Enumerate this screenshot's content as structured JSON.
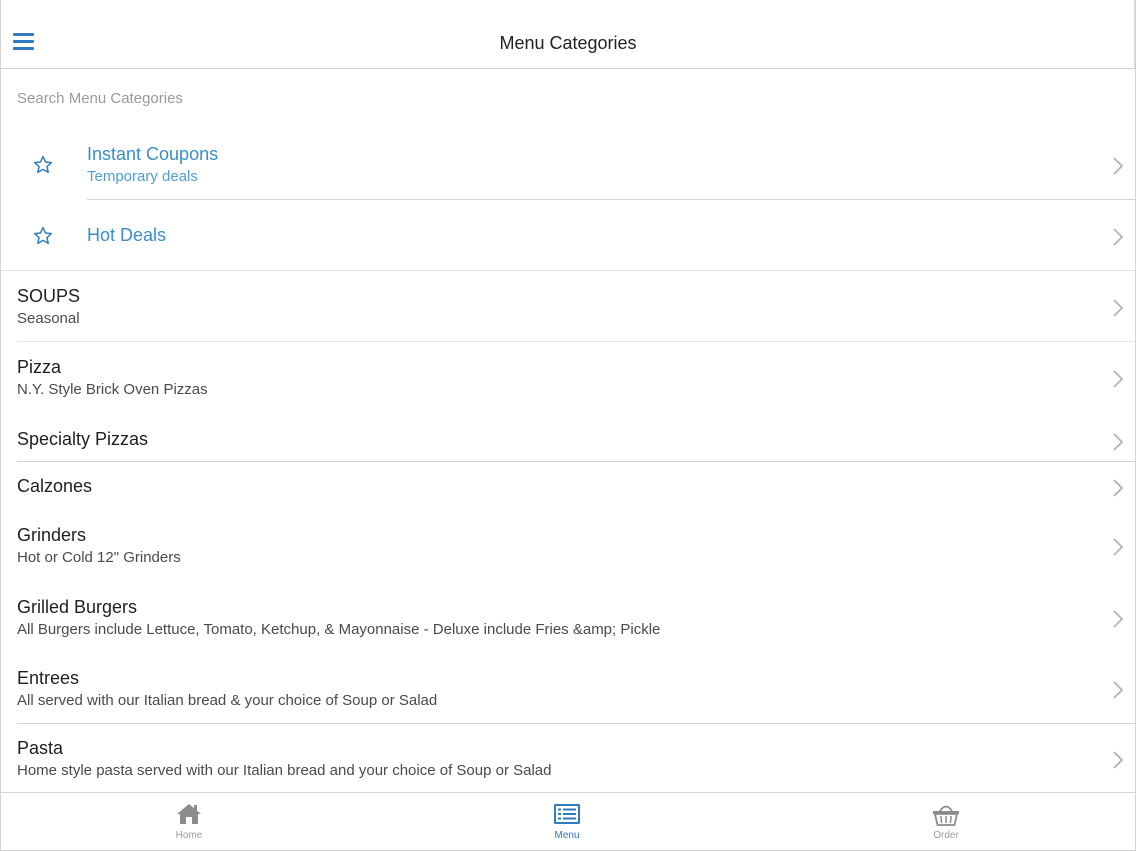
{
  "header": {
    "title": "Menu Categories",
    "menu_icon": "hamburger-icon"
  },
  "search": {
    "placeholder": "Search Menu Categories",
    "value": ""
  },
  "colors": {
    "accent": "#2f7bc0",
    "promo_text": "#3a8fc6"
  },
  "promos": [
    {
      "title": "Instant Coupons",
      "subtitle": "Temporary deals",
      "icon": "star-outline-icon"
    },
    {
      "title": "Hot Deals",
      "subtitle": "",
      "icon": "star-outline-icon"
    }
  ],
  "categories": [
    {
      "title": "SOUPS",
      "subtitle": "Seasonal"
    },
    {
      "title": "Pizza",
      "subtitle": "N.Y. Style Brick Oven Pizzas"
    },
    {
      "title": "Specialty Pizzas",
      "subtitle": ""
    },
    {
      "title": "Calzones",
      "subtitle": ""
    },
    {
      "title": "Grinders",
      "subtitle": "Hot or Cold 12\" Grinders"
    },
    {
      "title": "Grilled Burgers",
      "subtitle": "All Burgers include Lettuce, Tomato, Ketchup, & Mayonnaise - Deluxe include Fries &amp; Pickle"
    },
    {
      "title": "Entrees",
      "subtitle": "All served with our Italian bread & your choice of Soup or Salad"
    },
    {
      "title": "Pasta",
      "subtitle": "Home style pasta served with our Italian bread and your choice of Soup or Salad"
    }
  ],
  "tabs": [
    {
      "label": "Home",
      "icon": "home-icon",
      "active": false
    },
    {
      "label": "Menu",
      "icon": "menu-list-icon",
      "active": true
    },
    {
      "label": "Order",
      "icon": "basket-icon",
      "active": false
    }
  ]
}
